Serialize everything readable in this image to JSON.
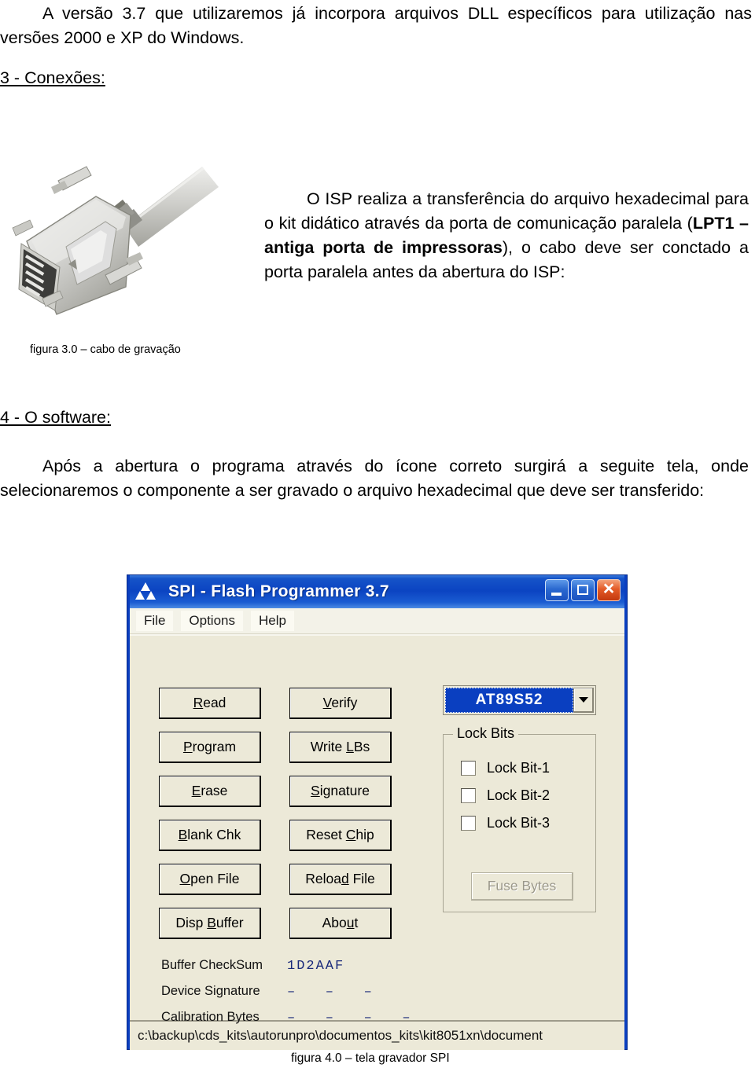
{
  "document": {
    "paragraph_1_html": "A versão 3.7 que utilizaremos já incorpora arquivos DLL específicos para utilização nas versões 2000 e XP do Windows.",
    "heading_3": "3 - Conexões:",
    "paragraph_isp_html": "O ISP realiza a transferência do arquivo hexadecimal para o kit didático através da porta de comunicação paralela (<b>LPT1 – antiga porta de impressoras</b>), o cabo deve ser conctado a porta paralela antes da abertura do ISP:",
    "figure_3_caption": "figura 3.0 – cabo de gravação",
    "heading_4": "4 - O software:",
    "paragraph_software_html": "Após a abertura o programa através do ícone correto surgirá a seguite tela, onde selecionaremos o componente a ser gravado o arquivo hexadecimal que deve ser transferido:",
    "figure_4_caption": "figura 4.0 – tela gravador SPI"
  },
  "figure_cable": {
    "alt": "cabo de gravação DB25 paralelo"
  },
  "spi_app": {
    "title": "SPI - Flash Programmer  3.7",
    "icon": "atmel-triangles-icon",
    "window_buttons": {
      "minimize": "minimize-button",
      "maximize": "maximize-button",
      "close": "close-button"
    },
    "menu": [
      "File",
      "Options",
      "Help"
    ],
    "buttons_left": [
      {
        "pre": "",
        "accel": "R",
        "post": "ead"
      },
      {
        "pre": "",
        "accel": "P",
        "post": "rogram"
      },
      {
        "pre": "",
        "accel": "E",
        "post": "rase"
      },
      {
        "pre": "",
        "accel": "B",
        "post": "lank Chk"
      },
      {
        "pre": "",
        "accel": "O",
        "post": "pen File"
      },
      {
        "pre": "Disp ",
        "accel": "B",
        "post": "uffer"
      }
    ],
    "buttons_right": [
      {
        "pre": "",
        "accel": "V",
        "post": "erify"
      },
      {
        "pre": "Write ",
        "accel": "L",
        "post": "Bs"
      },
      {
        "pre": "",
        "accel": "S",
        "post": "ignature"
      },
      {
        "pre": "Reset ",
        "accel": "C",
        "post": "hip"
      },
      {
        "pre": "Reloa",
        "accel": "d",
        "post": " File"
      },
      {
        "pre": "Abo",
        "accel": "u",
        "post": "t"
      }
    ],
    "device_select": {
      "value": "AT89S52",
      "options": [
        "AT89S52"
      ]
    },
    "lock_bits": {
      "legend": "Lock Bits",
      "items": [
        {
          "label": "Lock Bit-1",
          "checked": false
        },
        {
          "label": "Lock Bit-2",
          "checked": false
        },
        {
          "label": "Lock Bit-3",
          "checked": false
        }
      ],
      "fuse_bytes_label": "Fuse Bytes",
      "fuse_bytes_enabled": false
    },
    "status": [
      {
        "label": "Buffer CheckSum",
        "value": "1D2AAF"
      },
      {
        "label": "Device Signature",
        "value": "–   –   –"
      },
      {
        "label": "Calibration Bytes",
        "value": "–   –   –   –"
      }
    ],
    "path": "c:\\backup\\cds_kits\\autorunpro\\documentos_kits\\kit8051xn\\document"
  },
  "colors": {
    "title_bar_blue": "#0a3fc0",
    "window_face": "#ece9d8",
    "selection_blue": "#0a3fc0",
    "checksum_text": "#1a2a7a",
    "close_button_red": "#e35a27"
  }
}
